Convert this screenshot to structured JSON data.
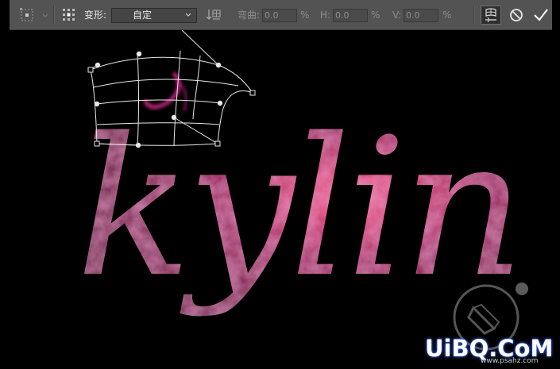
{
  "options_bar": {
    "warp_label": "变形:",
    "warp_style": "自定",
    "bend_label": "弯曲:",
    "bend_value": "0.0",
    "bend_unit": "%",
    "h_label": "H:",
    "h_value": "0.0",
    "h_unit": "%",
    "v_label": "V:",
    "v_value": "0.0",
    "v_unit": "%"
  },
  "canvas": {
    "text": "kylin"
  },
  "watermark": {
    "brand": "UiBQ.CoM",
    "sub": "www.psahz.com"
  },
  "colors": {
    "toolbar_bg": "#535353",
    "canvas_bg": "#000000",
    "text_base": "#a81c64",
    "text_glow": "#ff7fb0"
  },
  "icons": {
    "reference_point": "reference-point-icon",
    "warp_grid": "warp-grid-icon",
    "orientation": "warp-orientation-icon",
    "toggle_warp": "warp-toggle-icon",
    "cancel": "cancel-icon",
    "commit": "checkmark-icon"
  }
}
